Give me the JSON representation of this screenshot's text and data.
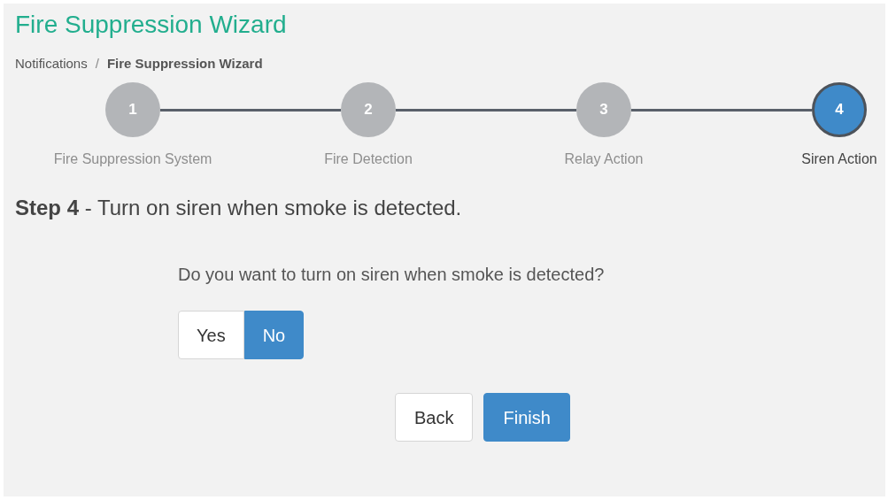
{
  "title": "Fire Suppression Wizard",
  "breadcrumb": [
    {
      "label": "Notifications",
      "current": false
    },
    {
      "label": "Fire Suppression Wizard",
      "current": true
    }
  ],
  "breadcrumb_separator": "/",
  "steps": [
    {
      "number": "1",
      "label": "Fire Suppression System",
      "selected": false
    },
    {
      "number": "2",
      "label": "Fire Detection",
      "selected": false
    },
    {
      "number": "3",
      "label": "Relay Action",
      "selected": false
    },
    {
      "number": "4",
      "label": "Siren Action",
      "selected": true
    }
  ],
  "step_heading": "**Step 4** - Turn on siren when smoke is detected.",
  "question": "Do you want to turn on siren when smoke is detected?",
  "options": [
    {
      "label": "Yes",
      "selected": false
    },
    {
      "label": "No",
      "selected": true
    }
  ],
  "buttons": [
    {
      "label": "Back",
      "kind": "default"
    },
    {
      "label": "Finish",
      "kind": "primary"
    }
  ]
}
